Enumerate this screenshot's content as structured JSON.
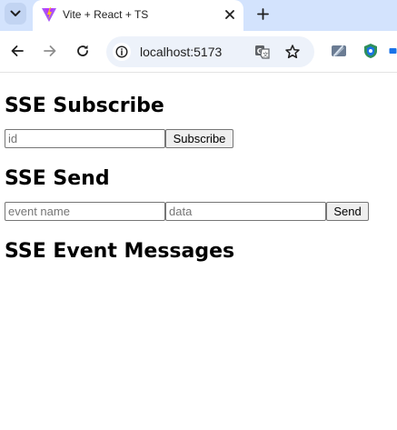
{
  "browser": {
    "tab_title": "Vite + React + TS",
    "url": "localhost:5173"
  },
  "page": {
    "subscribe": {
      "heading": "SSE Subscribe",
      "id_placeholder": "id",
      "button_label": "Subscribe"
    },
    "send": {
      "heading": "SSE Send",
      "event_placeholder": "event name",
      "data_placeholder": "data",
      "button_label": "Send"
    },
    "messages": {
      "heading": "SSE Event Messages"
    }
  }
}
